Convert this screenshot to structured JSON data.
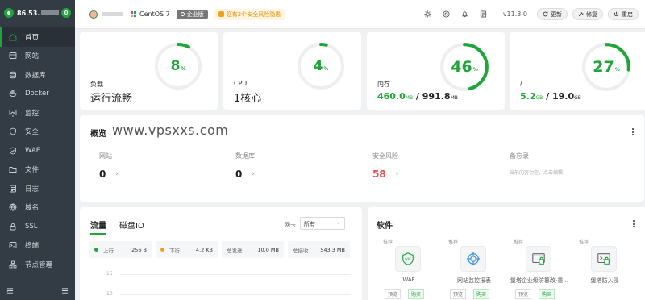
{
  "sidebar": {
    "host_ip": "86.53.",
    "msg_count": "0",
    "items": [
      {
        "label": "首页",
        "icon": "home-icon",
        "active": true
      },
      {
        "label": "网站",
        "icon": "globe-icon"
      },
      {
        "label": "数据库",
        "icon": "database-icon"
      },
      {
        "label": "Docker",
        "icon": "docker-icon"
      },
      {
        "label": "监控",
        "icon": "monitor-icon"
      },
      {
        "label": "安全",
        "icon": "shield-icon"
      },
      {
        "label": "WAF",
        "icon": "waf-icon"
      },
      {
        "label": "文件",
        "icon": "folder-icon"
      },
      {
        "label": "日志",
        "icon": "log-icon"
      },
      {
        "label": "域名",
        "icon": "domain-icon"
      },
      {
        "label": "SSL",
        "icon": "ssl-icon"
      },
      {
        "label": "终端",
        "icon": "terminal-icon"
      },
      {
        "label": "节点管理",
        "icon": "node-icon"
      }
    ]
  },
  "topbar": {
    "os": "CentOS 7",
    "edition": "企业版",
    "alert": "您有2个安全风险隐患",
    "version": "v11.3.0",
    "buttons": {
      "update": "更新",
      "repair": "修复",
      "restart": "重启"
    }
  },
  "stats": {
    "load": {
      "label": "负载",
      "value": "运行流畅",
      "percent": 8
    },
    "cpu": {
      "label": "CPU",
      "value": "1核心",
      "percent": 4
    },
    "memory": {
      "label": "内存",
      "used": "460.0",
      "used_unit": "MB",
      "sep": " / ",
      "total": "991.8",
      "total_unit": "MB",
      "percent": 46
    },
    "disk": {
      "label": "/",
      "used": "5.2",
      "used_unit": "GB",
      "sep": " / ",
      "total": "19.0",
      "total_unit": "GB",
      "percent": 27
    },
    "percent_unit": "%"
  },
  "overview": {
    "title": "概览",
    "watermark": "www.vpsxxs.com",
    "items": {
      "site": {
        "label": "网站",
        "value": "0"
      },
      "db": {
        "label": "数据库",
        "value": "0"
      },
      "risk": {
        "label": "安全风险",
        "value": "58"
      },
      "memo": {
        "label": "备忘录",
        "hint": "当前内容为空，点击编辑"
      }
    }
  },
  "traffic": {
    "tabs": [
      "流量",
      "磁盘IO"
    ],
    "nic_label": "网卡",
    "nic_value": "所有",
    "stats": [
      {
        "label": "上行",
        "value": "256 B",
        "color": "#20a53a"
      },
      {
        "label": "下行",
        "value": "4.2 KB",
        "color": "#f0a020"
      },
      {
        "label": "总发送",
        "value": "10.0 MB"
      },
      {
        "label": "总接收",
        "value": "543.3 MB"
      }
    ],
    "yticks": [
      "15",
      "10"
    ]
  },
  "software": {
    "title": "软件",
    "recommend": "推荐",
    "preview": "预览",
    "buy": "购买",
    "items": [
      "WAF",
      "网站监控报表",
      "堡塔企业级防篡改-重...",
      "堡塔防入侵"
    ]
  },
  "colors": {
    "accent": "#20a53a",
    "danger": "#e24c4c",
    "sidebar": "#333b44"
  }
}
